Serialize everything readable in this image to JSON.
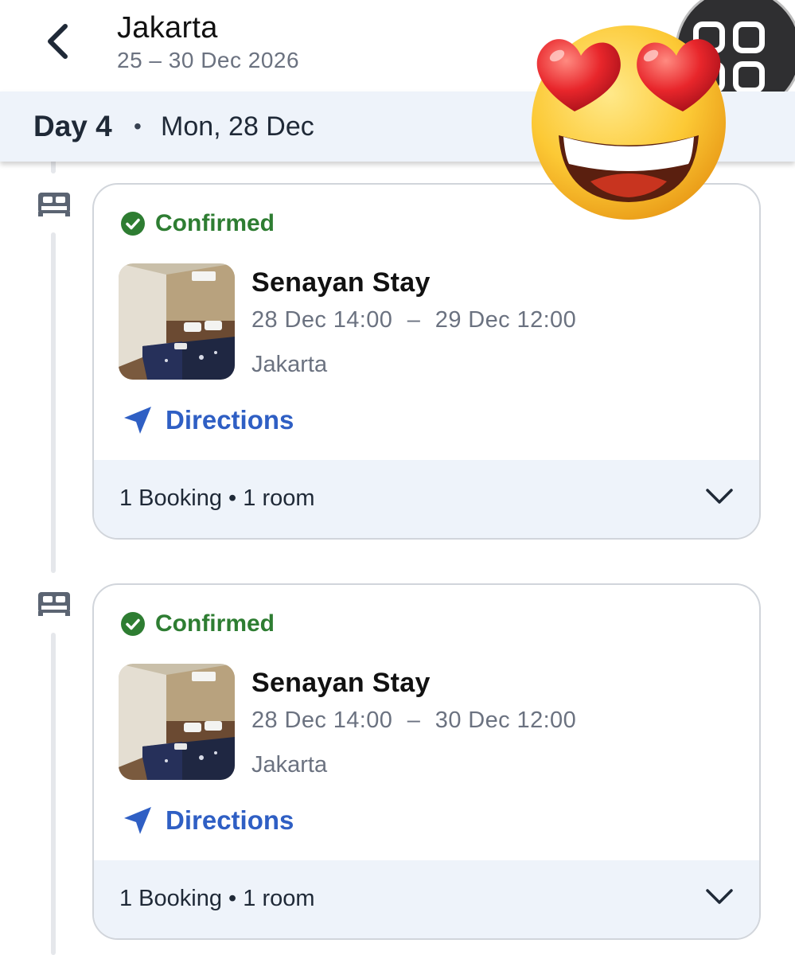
{
  "header": {
    "title": "Jakarta",
    "date_range": "25 – 30 Dec 2026",
    "back_icon": "chevron-left-icon",
    "menu_icon": "grid-menu-icon"
  },
  "day_header": {
    "label": "Day 4",
    "separator": "•",
    "date": "Mon, 28 Dec"
  },
  "sticker": {
    "emoji": "heart-eyes-face",
    "description_icon": "heart-eyes-emoji-icon"
  },
  "bookings": [
    {
      "status": "Confirmed",
      "name": "Senayan Stay",
      "checkin": "28 Dec 14:00",
      "dash": "–",
      "checkout": "29 Dec 12:00",
      "location": "Jakarta",
      "directions_label": "Directions",
      "summary": "1 Booking • 1 room"
    },
    {
      "status": "Confirmed",
      "name": "Senayan Stay",
      "checkin": "28 Dec 14:00",
      "dash": "–",
      "checkout": "30 Dec 12:00",
      "location": "Jakarta",
      "directions_label": "Directions",
      "summary": "1 Booking • 1 room"
    }
  ],
  "colors": {
    "confirmed_green": "#2e7d32",
    "link_blue": "#2f5fc4",
    "header_bg": "#eef3fa",
    "muted_text": "#6b7280"
  }
}
